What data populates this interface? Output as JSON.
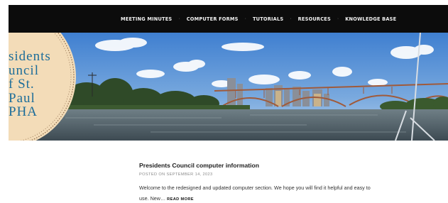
{
  "nav": {
    "items": [
      {
        "label": "MEETING MINUTES"
      },
      {
        "label": "COMPUTER FORMS"
      },
      {
        "label": "TUTORIALS"
      },
      {
        "label": "RESOURCES"
      },
      {
        "label": "KNOWLEDGE BASE"
      }
    ],
    "separator": "·"
  },
  "header": {
    "logo_lines": [
      "sidents",
      "uncil",
      "f St.",
      "Paul",
      "PHA"
    ]
  },
  "post": {
    "title": "Presidents Council computer information",
    "meta_prefix": "POSTED ON",
    "date": "SEPTEMBER 14, 2023",
    "excerpt": "Welcome to the redesigned and updated computer section. We hope you will find it helpful and easy to use. New…",
    "read_more": "READ MORE"
  },
  "colors": {
    "nav_background": "#0c0c0c",
    "logo_circle": "#f3dcb8",
    "logo_ring": "#8c6a4a",
    "logo_text": "#1c6d9a"
  }
}
